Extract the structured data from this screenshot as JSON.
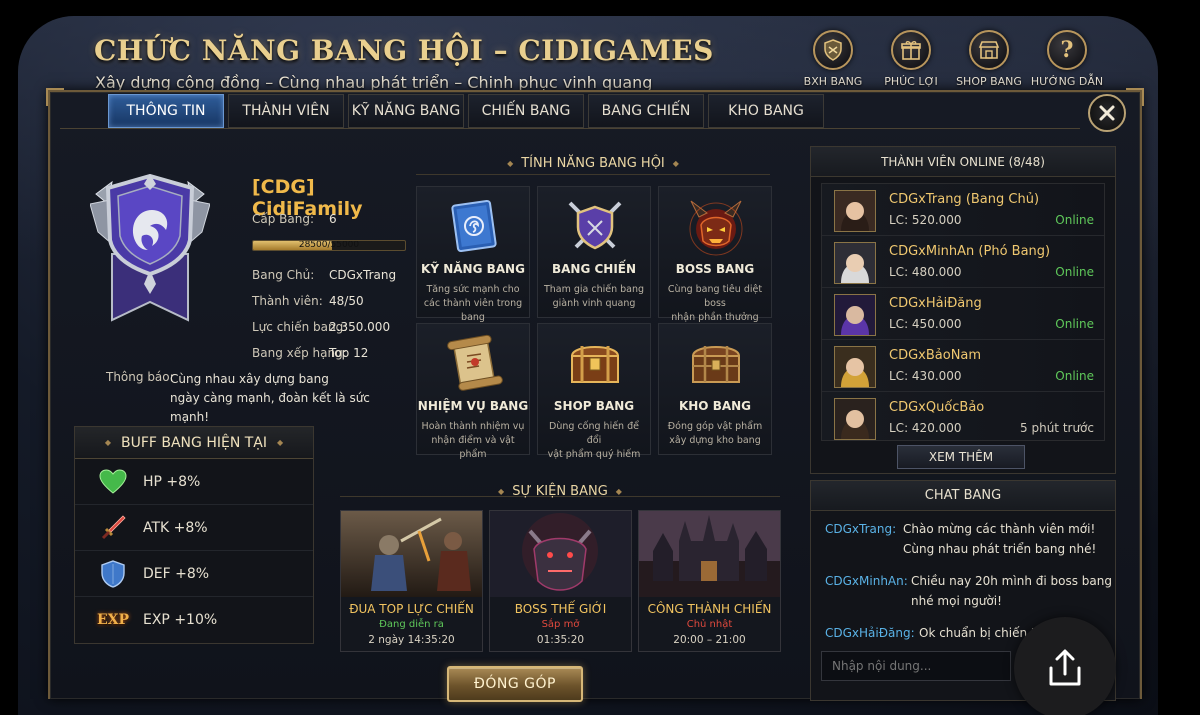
{
  "header": {
    "title": "CHỨC NĂNG BANG HỘI – CIDIGAMES",
    "subtitle": "Xây dựng cộng đồng – Cùng nhau phát triển – Chinh phục vinh quang"
  },
  "top_icons": [
    {
      "label": "BXH BANG",
      "icon": "ranking-shield-icon"
    },
    {
      "label": "PHÚC LỢI",
      "icon": "gift-icon"
    },
    {
      "label": "SHOP BANG",
      "icon": "shop-icon"
    },
    {
      "label": "HƯỚNG DẪN",
      "icon": "help-icon"
    }
  ],
  "tabs": [
    {
      "label": "THÔNG TIN",
      "active": true
    },
    {
      "label": "THÀNH VIÊN"
    },
    {
      "label": "KỸ NĂNG BANG"
    },
    {
      "label": "CHIẾN BANG"
    },
    {
      "label": "BANG CHIẾN"
    },
    {
      "label": "KHO BANG"
    }
  ],
  "guild": {
    "name": "[CDG] CidiFamily",
    "level_label": "Cấp Bang:",
    "level": "6",
    "xp_text": "28500/55000",
    "xp_fraction": 0.518,
    "leader_label": "Bang Chủ:",
    "leader": "CDGxTrang",
    "members_label": "Thành viên:",
    "members": "48/50",
    "power_label": "Lực chiến bang:",
    "power": "2.350.000",
    "rank_label": "Bang xếp hạng:",
    "rank": "Top 12",
    "notice_label": "Thông báo:",
    "notice_line1": "Cùng nhau xây dựng bang",
    "notice_line2": "ngày càng mạnh, đoàn kết là sức mạnh!"
  },
  "buffs": {
    "title": "BUFF BANG HIỆN TẠI",
    "items": [
      {
        "text": "HP +8%",
        "icon": "heart-icon"
      },
      {
        "text": "ATK +8%",
        "icon": "sword-icon"
      },
      {
        "text": "DEF +8%",
        "icon": "shield-icon"
      },
      {
        "text": "EXP +10%",
        "icon": "exp-icon",
        "badge": "EXP"
      }
    ]
  },
  "features": {
    "title": "TÍNH NĂNG BANG HỘI",
    "items": [
      {
        "name": "KỸ NĂNG BANG",
        "desc1": "Tăng sức mạnh cho",
        "desc2": "các thành viên trong bang",
        "icon": "skill-book-icon"
      },
      {
        "name": "BANG CHIẾN",
        "desc1": "Tham gia chiến bang",
        "desc2": "giành vinh quang",
        "icon": "crossed-swords-shield-icon"
      },
      {
        "name": "BOSS BANG",
        "desc1": "Cùng bang tiêu diệt boss",
        "desc2": "nhận phần thưởng lớn",
        "icon": "demon-boss-icon"
      },
      {
        "name": "NHIỆM VỤ BANG",
        "desc1": "Hoàn thành nhiệm vụ",
        "desc2": "nhận điểm và vật phẩm",
        "icon": "scroll-icon"
      },
      {
        "name": "SHOP BANG",
        "desc1": "Dùng cống hiến để đổi",
        "desc2": "vật phẩm quý hiếm",
        "icon": "treasure-chest-icon"
      },
      {
        "name": "KHO BANG",
        "desc1": "Đóng góp vật phẩm",
        "desc2": "xây dựng kho bang",
        "icon": "storage-chest-icon"
      }
    ]
  },
  "events": {
    "title": "SỰ KIỆN BANG",
    "items": [
      {
        "name": "ĐUA TOP LỰC CHIẾN",
        "status": "Đang diễn ra",
        "status_color": "#5fc85a",
        "time": "2 ngày 14:35:20"
      },
      {
        "name": "BOSS THẾ GIỚI",
        "status": "Sắp mở",
        "status_color": "#e0493d",
        "time": "01:35:20"
      },
      {
        "name": "CÔNG THÀNH CHIẾN",
        "status": "Chủ nhật",
        "status_color": "#e0493d",
        "time": "20:00 – 21:00"
      }
    ]
  },
  "donate_label": "ĐÓNG GÓP",
  "online": {
    "title": "THÀNH VIÊN ONLINE (8/48)",
    "members": [
      {
        "name": "CDGxTrang (Bang Chủ)",
        "lc": "LC: 520.000",
        "status": "Online",
        "status_color": "#5fc85a",
        "hair": "#2a1d17"
      },
      {
        "name": "CDGxMinhAn (Phó Bang)",
        "lc": "LC: 480.000",
        "status": "Online",
        "status_color": "#5fc85a",
        "hair": "#d9d9d9"
      },
      {
        "name": "CDGxHảiĐăng",
        "lc": "LC: 450.000",
        "status": "Online",
        "status_color": "#5fc85a",
        "hair": "#5b35a8"
      },
      {
        "name": "CDGxBảoNam",
        "lc": "LC: 430.000",
        "status": "Online",
        "status_color": "#5fc85a",
        "hair": "#d2a238"
      },
      {
        "name": "CDGxQuốcBảo",
        "lc": "LC: 420.000",
        "status": "5 phút trước",
        "status_color": "#cfc9bb",
        "hair": "#3a2a1e"
      }
    ],
    "see_more": "XEM THÊM"
  },
  "chat": {
    "title": "CHAT BANG",
    "messages": [
      {
        "who": "CDGxTrang:",
        "line1": "Chào mừng các thành viên mới!",
        "line2": "Cùng nhau phát triển bang nhé!"
      },
      {
        "who": "CDGxMinhAn:",
        "line1": "Chiều nay 20h mình đi boss bang",
        "line2": "nhé mọi người!"
      },
      {
        "who": "CDGxHảiĐăng:",
        "line1": "Ok chuẩn bị chiến thôi!"
      }
    ],
    "placeholder": "Nhập nội dung..."
  },
  "colors": {
    "gold": "#e9cf8f",
    "accent_blue": "#2f5d9a",
    "online_green": "#5fc85a",
    "name_orange": "#f0c870"
  }
}
